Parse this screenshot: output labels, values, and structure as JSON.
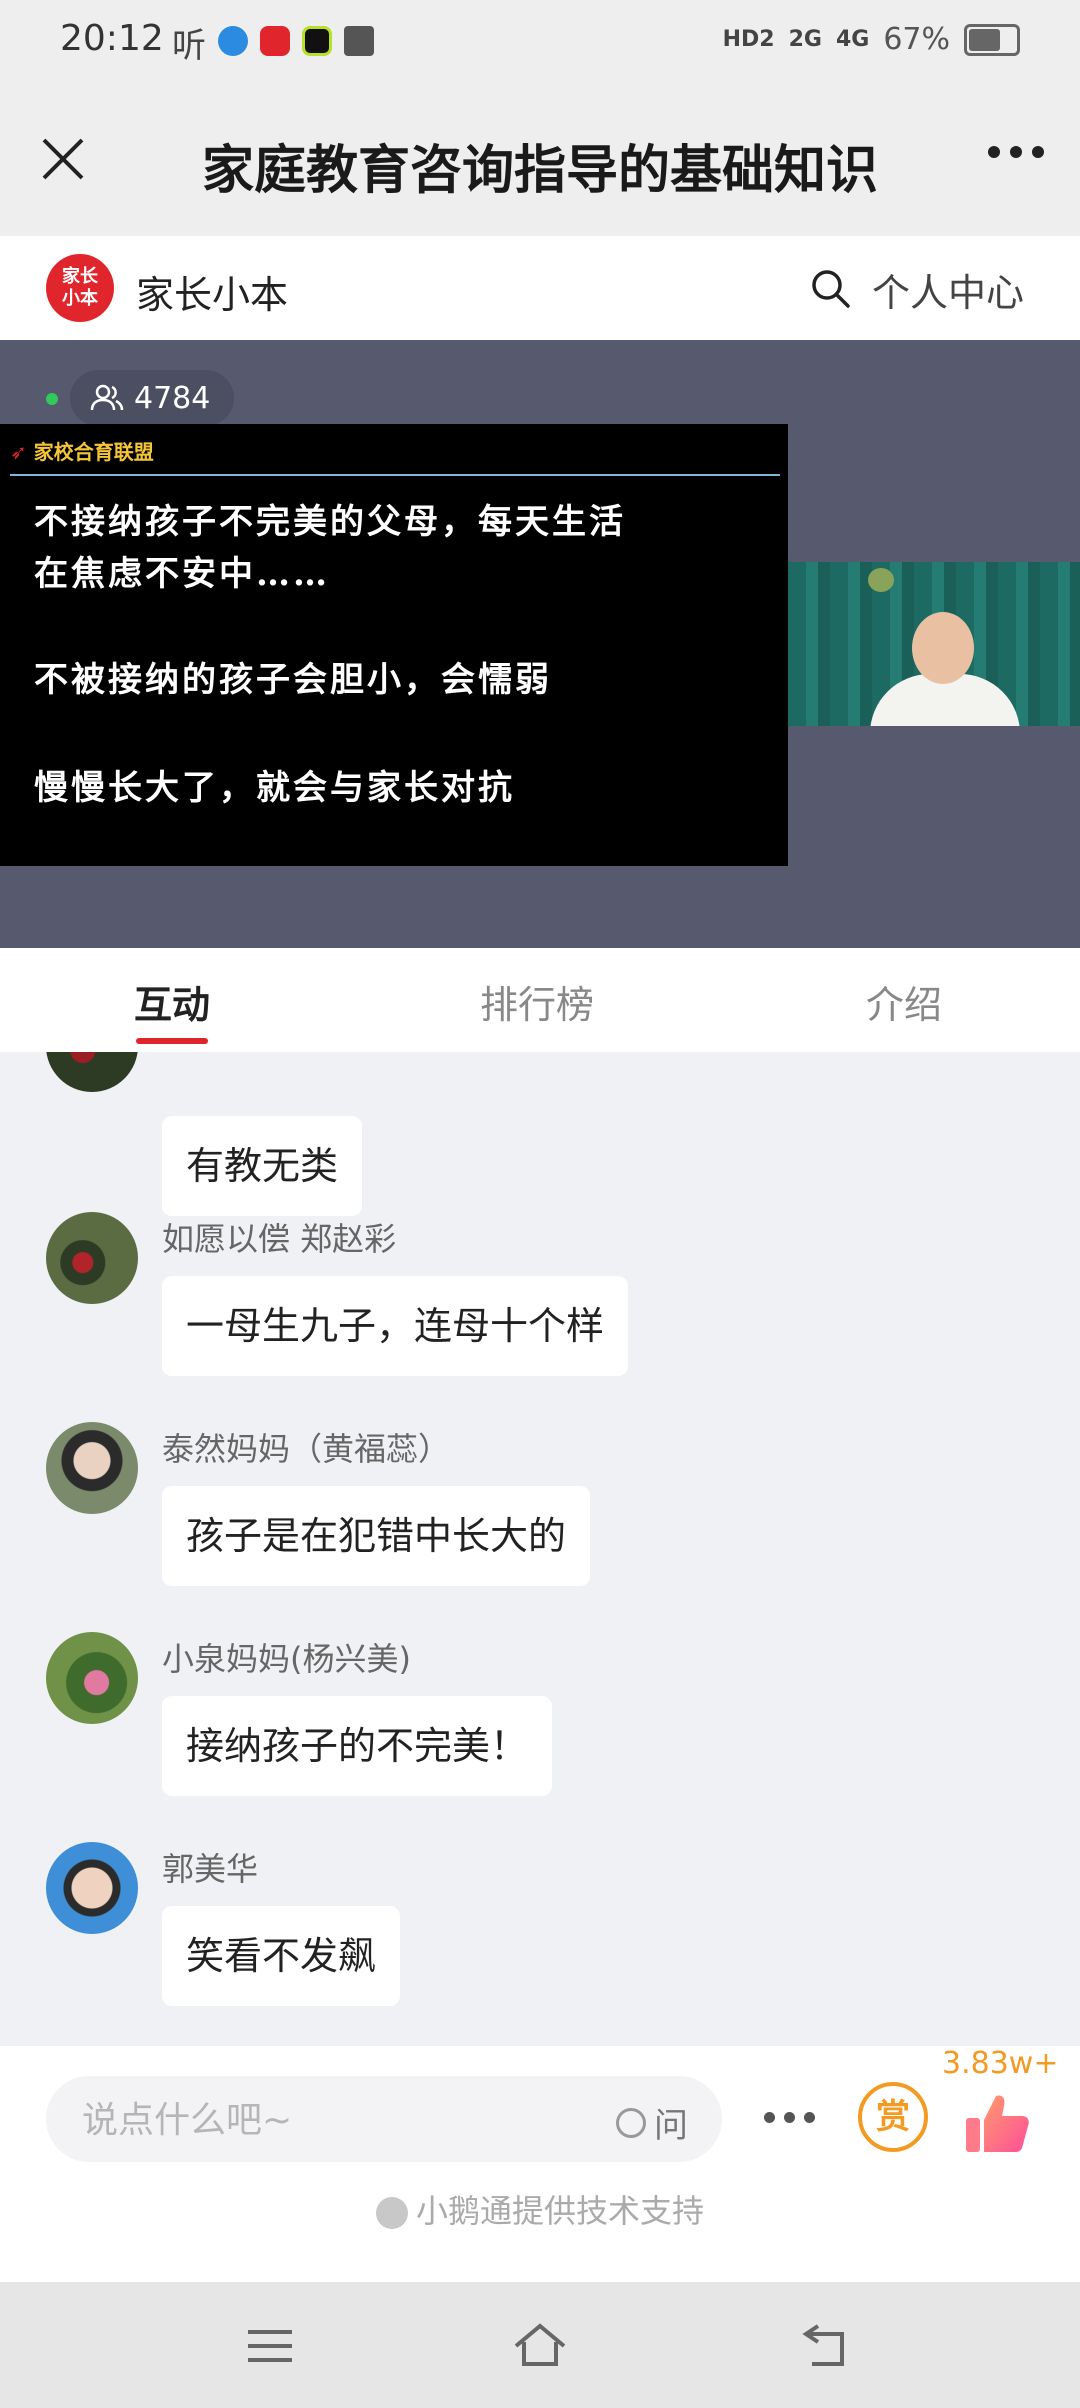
{
  "status_bar": {
    "time": "20:12",
    "app_indicator": "听",
    "network": [
      "HD2",
      "2G",
      "4G"
    ],
    "battery": "67%"
  },
  "header": {
    "title": "家庭教育咨询指导的基础知识"
  },
  "brand_bar": {
    "logo_text_line1": "家长",
    "logo_text_line2": "小本",
    "brand_name": "家长小本",
    "personal_center": "个人中心"
  },
  "live": {
    "viewer_count": "4784",
    "slide_header": "家校合育联盟",
    "slide_lines": [
      "不接纳孩子不完美的父母，每天生活",
      "在焦虑不安中……",
      "不被接纳的孩子会胆小，会懦弱",
      "慢慢长大了，就会与家长对抗"
    ]
  },
  "tabs": [
    {
      "label": "互动",
      "active": true
    },
    {
      "label": "排行榜",
      "active": false
    },
    {
      "label": "介绍",
      "active": false
    }
  ],
  "messages": [
    {
      "user": "",
      "text": "有教无类"
    },
    {
      "user": "如愿以偿 郑赵彩",
      "text": "一母生九子，连母十个样"
    },
    {
      "user": "泰然妈妈（黄福蕊）",
      "text": "孩子是在犯错中长大的"
    },
    {
      "user": "小泉妈妈(杨兴美)",
      "text": "接纳孩子的不完美！"
    },
    {
      "user": "郭美华",
      "text": "笑看不发飙"
    }
  ],
  "composer": {
    "placeholder": "说点什么吧~",
    "ask_label": "问",
    "reward_label": "赏",
    "like_count": "3.83w+",
    "support_text": "小鹅通提供技术支持"
  },
  "colors": {
    "brand_red": "#e0262c",
    "reward_orange": "#f39a22",
    "live_green": "#31c95a"
  }
}
